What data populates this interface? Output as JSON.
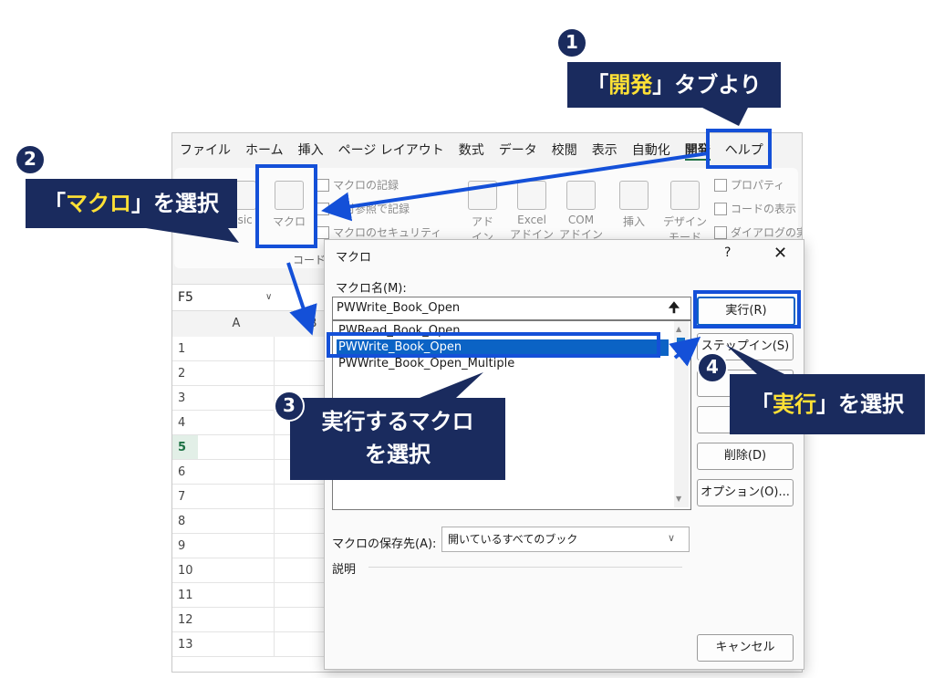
{
  "ribbon_tabs": [
    "ファイル",
    "ホーム",
    "挿入",
    "ページ レイアウト",
    "数式",
    "データ",
    "校閲",
    "表示",
    "自動化",
    "開発",
    "ヘルプ"
  ],
  "active_tab": "開発",
  "ribbon": {
    "basic": "asic",
    "macro": "マクロ",
    "record_macro": "マクロの記録",
    "relative_ref": "相対参照で記録",
    "macro_security": "マクロのセキュリティ",
    "code_group": "コード",
    "addins": "アド\nイン",
    "excel_addins": "Excel\nアドイン",
    "com_addins": "COM\nアドイン",
    "insert": "挿入",
    "design_mode": "デザイン\nモード",
    "properties": "プロパティ",
    "view_code": "コードの表示",
    "run_dialog": "ダイアログの実行"
  },
  "name_box": "F5",
  "columns": [
    "A",
    "B"
  ],
  "rows": [
    "1",
    "2",
    "3",
    "4",
    "5",
    "6",
    "7",
    "8",
    "9",
    "10",
    "11",
    "12",
    "13"
  ],
  "selected_row": "5",
  "dialog": {
    "title": "マクロ",
    "help": "?",
    "close": "✕",
    "macro_name_label": "マクロ名(M):",
    "macro_name_value": "PWWrite_Book_Open",
    "up_arrow": "🠉",
    "macros": [
      "PWRead_Book_Open",
      "PWWrite_Book_Open",
      "PWWrite_Book_Open_Multiple"
    ],
    "selected_macro": "PWWrite_Book_Open",
    "buttons": {
      "run": "実行(R)",
      "step_in": "ステップイン(S)",
      "delete": "削除(D)",
      "options": "オプション(O)...",
      "cancel": "キャンセル"
    },
    "store_label": "マクロの保存先(A):",
    "store_value": "開いているすべてのブック",
    "description_label": "説明"
  },
  "annotations": {
    "step1": {
      "num": "1",
      "pre": "「",
      "hl": "開発",
      "post": "」タブより"
    },
    "step2": {
      "num": "2",
      "pre": "「",
      "hl": "マクロ",
      "post": "」を選択"
    },
    "step3": {
      "num": "3",
      "line1": "実行するマクロ",
      "line2": "を選択"
    },
    "step4": {
      "num": "4",
      "pre": "「",
      "hl": "実行",
      "post": "」を選択"
    }
  },
  "colors": {
    "callout_bg": "#1a2b5e",
    "highlight_text": "#ffe135",
    "frame": "#1450d8",
    "selection": "#0b63c5"
  }
}
